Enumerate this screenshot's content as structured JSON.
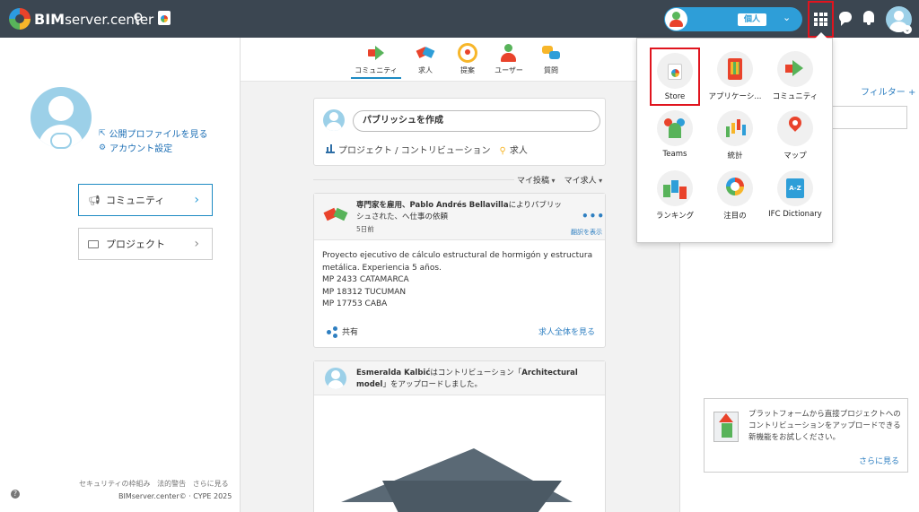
{
  "topbar": {
    "brand_bold": "BIM",
    "brand_light": "server.center",
    "profile_badge": "個人"
  },
  "left": {
    "public_profile_link": "公開プロファイルを見る",
    "account_settings_link": "アカウント設定",
    "nav": [
      {
        "label": "コミュニティ"
      },
      {
        "label": "プロジェクト"
      }
    ],
    "footer_links": [
      "セキュリティの枠組み",
      "法的警告",
      "さらに見る"
    ],
    "copyright": "BIMserver.center© · CYPE 2025"
  },
  "tabs": [
    {
      "label": "コミュニティ",
      "icon": "megaphone-icon"
    },
    {
      "label": "求人",
      "icon": "handshake-icon"
    },
    {
      "label": "提案",
      "icon": "lightbulb-icon"
    },
    {
      "label": "ユーザー",
      "icon": "people-icon"
    },
    {
      "label": "質問",
      "icon": "question-bubbles-icon"
    }
  ],
  "publish": {
    "placeholder": "パブリッシュを作成",
    "project_action": "プロジェクト / コントリビューション",
    "job_action": "求人"
  },
  "filters": {
    "my_posts": "マイ投稿",
    "my_jobs": "マイ求人"
  },
  "posts": [
    {
      "title_bold": "専門家を雇用、Pablo Andrés Bellavilla",
      "title_rest": "によりパブリッシュされた、へ仕事の依頼",
      "time": "5日前",
      "translate": "翻訳を表示",
      "body": [
        "Proyecto ejecutivo de cálculo estructural de hormigón y estructura metálica. Experiencia 5 años.",
        "MP 2433 CATAMARCA",
        "MP 18312 TUCUMAN",
        "MP 17753 CABA"
      ],
      "share": "共有",
      "see_all": "求人全体を見る"
    },
    {
      "title_bold": "Esmeralda Kalbić",
      "title_mid": "はコントリビューション「",
      "title_bold2": "Architectural model",
      "title_rest": "」をアップロードしました。"
    }
  ],
  "right": {
    "filter_link": "フィルター +",
    "promo_text": "プラットフォームから直接プロジェクトへのコントリビューションをアップロードできる新機能をお試しください。",
    "promo_more": "さらに見る"
  },
  "apps_menu": [
    {
      "label": "Store",
      "icon": "store-bag-icon"
    },
    {
      "label": "アプリケーシ...",
      "icon": "phone-apps-icon"
    },
    {
      "label": "コミュニティ",
      "icon": "megaphone-icon"
    },
    {
      "label": "Teams",
      "icon": "teams-icon"
    },
    {
      "label": "統計",
      "icon": "statistics-icon"
    },
    {
      "label": "マップ",
      "icon": "map-pin-icon"
    },
    {
      "label": "ランキング",
      "icon": "ranking-icon"
    },
    {
      "label": "注目の",
      "icon": "featured-icon"
    },
    {
      "label": "IFC Dictionary",
      "icon": "ifc-dictionary-icon"
    }
  ],
  "colors": {
    "topbar": "#3b4651",
    "accent": "#2e9ed8",
    "highlight": "#e0141e"
  }
}
